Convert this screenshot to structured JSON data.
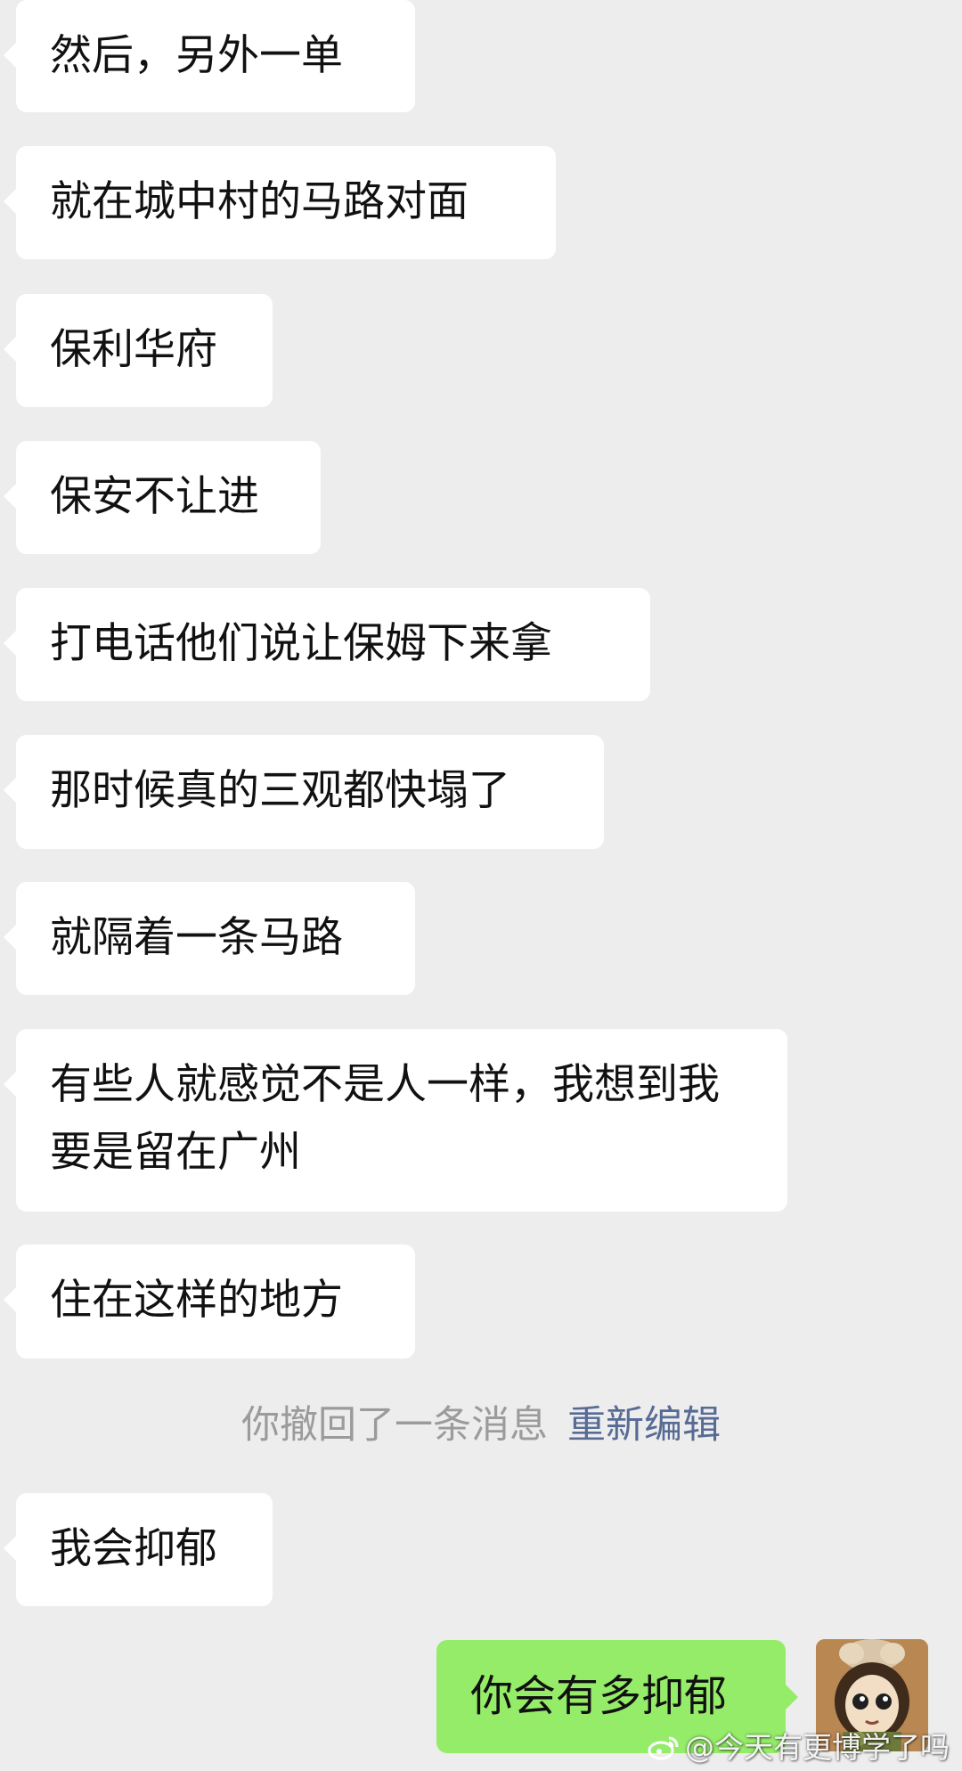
{
  "messages": [
    {
      "side": "incoming",
      "text": "然后，另外一单"
    },
    {
      "side": "incoming",
      "text": "就在城中村的马路对面"
    },
    {
      "side": "incoming",
      "text": "保利华府"
    },
    {
      "side": "incoming",
      "text": "保安不让进"
    },
    {
      "side": "incoming",
      "text": "打电话他们说让保姆下来拿"
    },
    {
      "side": "incoming",
      "text": "那时候真的三观都快塌了"
    },
    {
      "side": "incoming",
      "text": "就隔着一条马路"
    },
    {
      "side": "incoming",
      "text": "有些人就感觉不是人一样，我想到我要是留在广州"
    },
    {
      "side": "incoming",
      "text": "住在这样的地方"
    },
    {
      "side": "incoming",
      "text": "我会抑郁"
    },
    {
      "side": "outgoing",
      "text": "你会有多抑郁"
    }
  ],
  "system_notice": {
    "text": "你撤回了一条消息",
    "action": "重新编辑"
  },
  "watermark": {
    "icon": "weibo-logo",
    "text": "@今天有更博学了吗"
  },
  "colors": {
    "background": "#ededed",
    "incoming_bubble": "#ffffff",
    "outgoing_bubble": "#95ec69",
    "notice_text": "#9b9b9b",
    "reedit_link": "#576b95"
  }
}
